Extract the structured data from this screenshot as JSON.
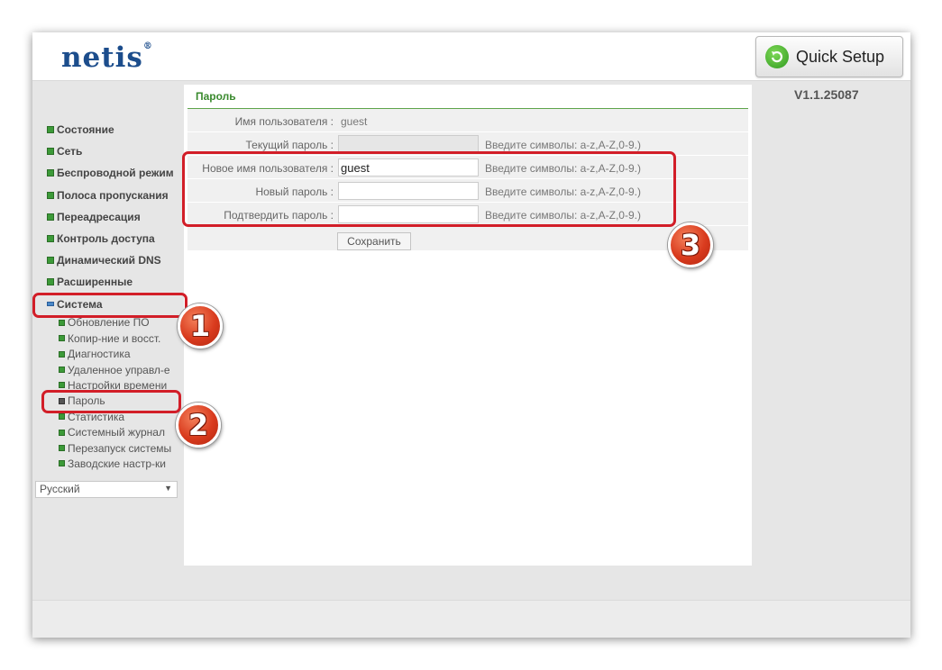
{
  "header": {
    "logo": "netis",
    "logo_mark": "®",
    "quick_setup_label": "Quick Setup",
    "version": "V1.1.25087"
  },
  "sidebar": {
    "items": [
      {
        "label": "Состояние",
        "icon": "plus-square-icon"
      },
      {
        "label": "Сеть",
        "icon": "plus-square-icon"
      },
      {
        "label": "Беспроводной режим",
        "icon": "plus-square-icon"
      },
      {
        "label": "Полоса пропускания",
        "icon": "plus-square-icon"
      },
      {
        "label": "Переадресация",
        "icon": "plus-square-icon"
      },
      {
        "label": "Контроль доступа",
        "icon": "plus-square-icon"
      },
      {
        "label": "Динамический DNS",
        "icon": "plus-square-icon"
      },
      {
        "label": "Расширенные",
        "icon": "plus-square-icon"
      },
      {
        "label": "Система",
        "icon": "minus-square-icon"
      }
    ],
    "system_subitems": [
      "Обновление ПО",
      "Копир-ние и восст.",
      "Диагностика",
      "Удаленное управл-е",
      "Настройки времени",
      "Пароль",
      "Статистика",
      "Системный журнал",
      "Перезапуск системы",
      "Заводские настр-ки"
    ],
    "active_subitem": "Пароль",
    "language": "Русский"
  },
  "content": {
    "title": "Пароль",
    "rows": [
      {
        "label": "Имя пользователя :",
        "value": "guest"
      },
      {
        "label": "Текущий пароль :",
        "value": "",
        "hint": "Введите символы: a-z,A-Z,0-9.)"
      },
      {
        "label": "Новое имя пользователя :",
        "value": "guest",
        "hint": "Введите символы: a-z,A-Z,0-9.)"
      },
      {
        "label": "Новый пароль :",
        "value": "",
        "hint": "Введите символы: a-z,A-Z,0-9.)"
      },
      {
        "label": "Подтвердить пароль :",
        "value": "",
        "hint": "Введите символы: a-z,A-Z,0-9.)"
      }
    ],
    "save_label": "Сохранить"
  },
  "annotations": {
    "step1": "1",
    "step2": "2",
    "step3": "3",
    "color": "#d21e28"
  },
  "colors": {
    "accent_green": "#3a8a2e",
    "logo_blue": "#1c4d8c"
  }
}
